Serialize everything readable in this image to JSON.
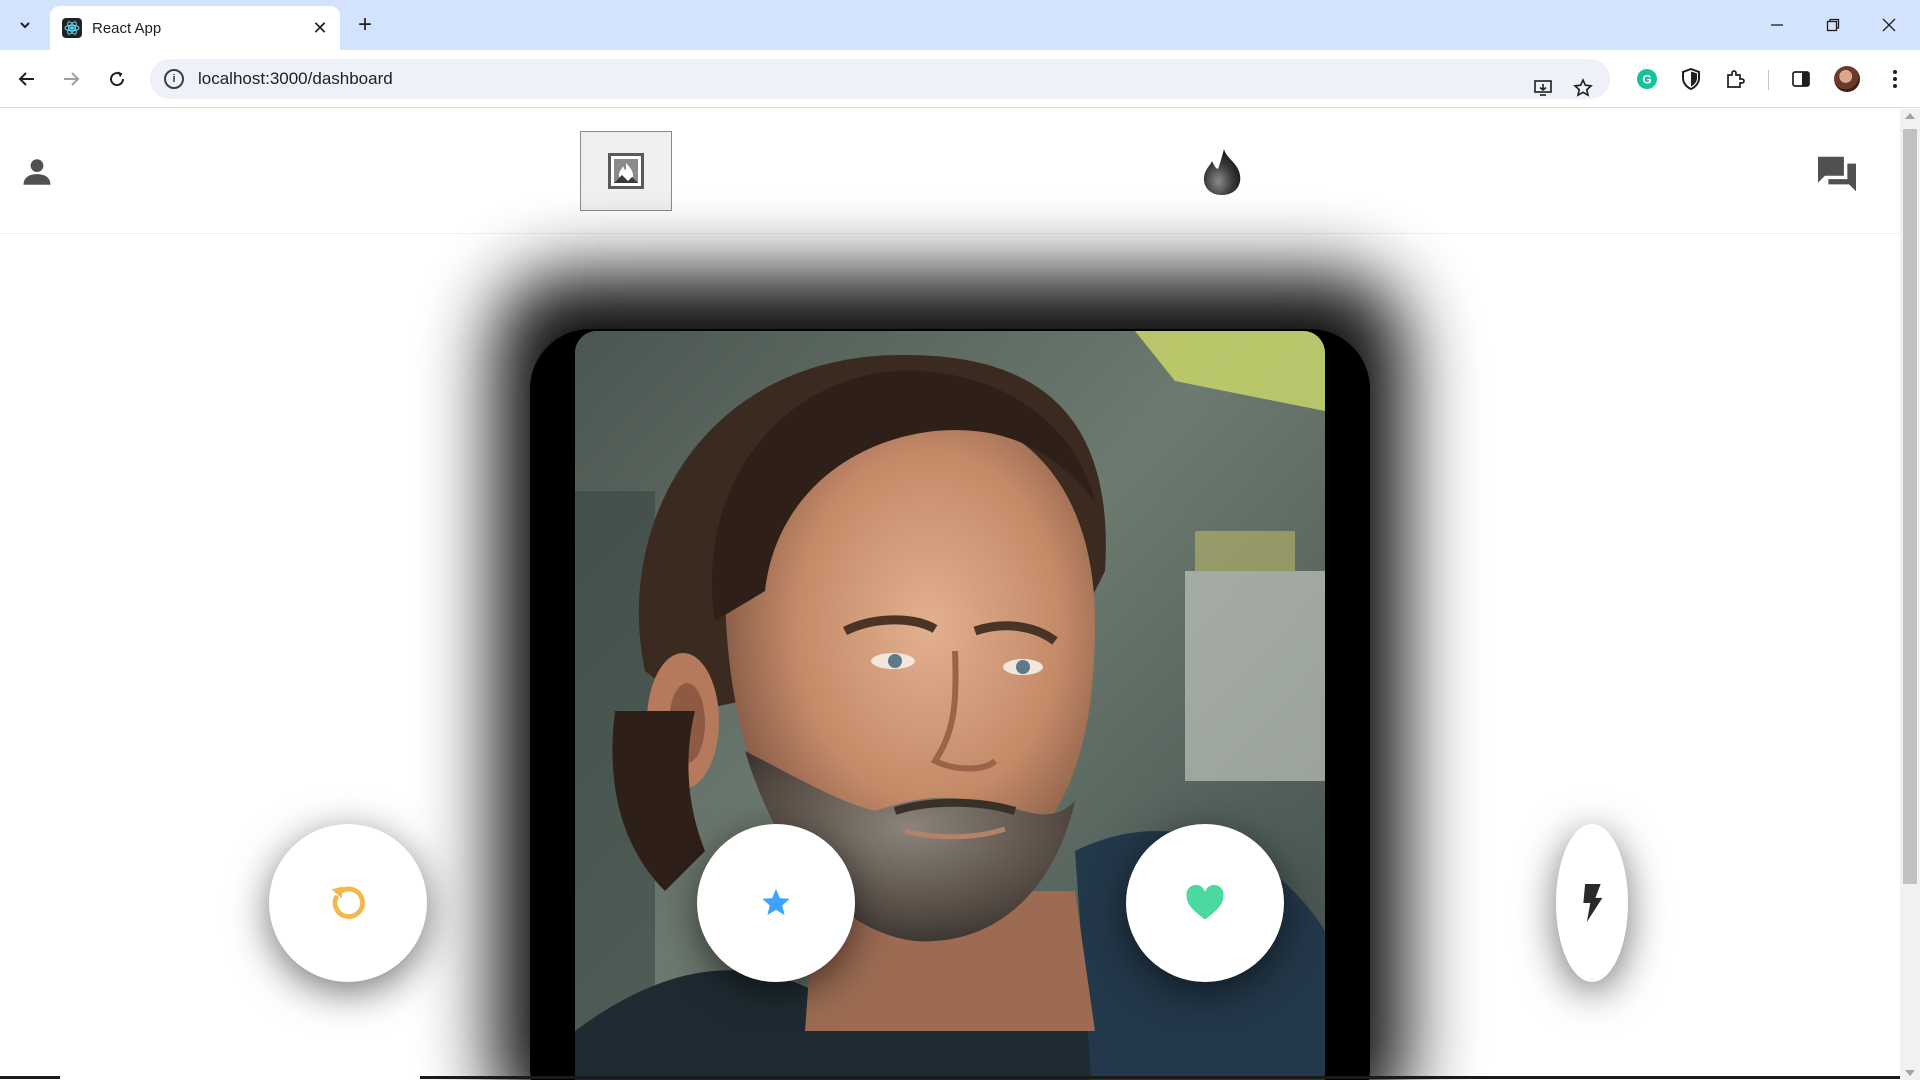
{
  "browser": {
    "tab_title": "React App",
    "url": "localhost:3000/dashboard"
  },
  "app": {
    "header_icons": [
      "person-icon",
      "app-logo-image",
      "flame-icon",
      "chat-icon"
    ],
    "card": {
      "photo": "profile-photo"
    },
    "actions": [
      {
        "name": "rewind-button",
        "icon": "replay-icon",
        "color": "#f5b748"
      },
      {
        "name": "super-like-button",
        "icon": "star-icon",
        "color": "#3ca4ff"
      },
      {
        "name": "like-button",
        "icon": "heart-icon",
        "color": "#4cd9a0"
      },
      {
        "name": "boost-button",
        "icon": "lightning-icon",
        "color": "#1f1f1f"
      }
    ]
  },
  "colors": {
    "tabstrip": "#d3e3fd",
    "rewind": "#f5b748",
    "star": "#3ca4ff",
    "heart": "#4cd9a0",
    "header_icons": "#505050"
  }
}
